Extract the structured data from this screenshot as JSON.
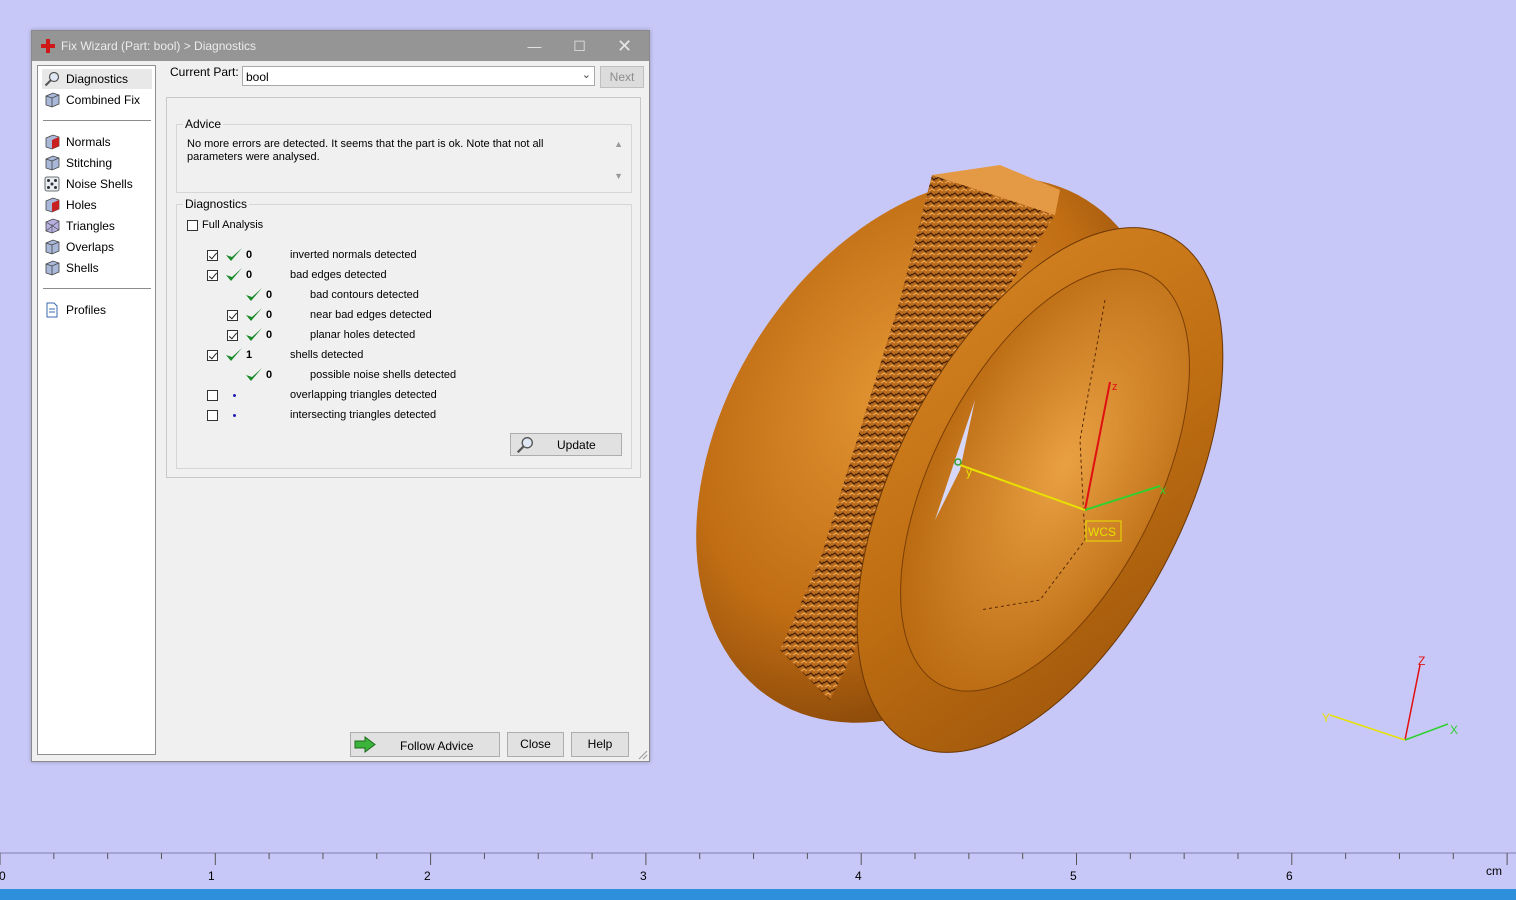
{
  "window": {
    "title": "Fix Wizard (Part: bool) > Diagnostics"
  },
  "nav": {
    "items": [
      {
        "label": "Diagnostics",
        "icon": "magnifier-icon"
      },
      {
        "label": "Combined Fix",
        "icon": "cube-icon"
      },
      {
        "label": "Normals",
        "icon": "cube-red-icon"
      },
      {
        "label": "Stitching",
        "icon": "cube-icon"
      },
      {
        "label": "Noise Shells",
        "icon": "dice-icon"
      },
      {
        "label": "Holes",
        "icon": "cube-icon"
      },
      {
        "label": "Triangles",
        "icon": "cube-icon"
      },
      {
        "label": "Overlaps",
        "icon": "cube-icon"
      },
      {
        "label": "Shells",
        "icon": "cube-icon"
      },
      {
        "label": "Profiles",
        "icon": "document-icon"
      }
    ]
  },
  "current_part": {
    "label": "Current Part:",
    "value": "bool",
    "next_label": "Next"
  },
  "advice": {
    "title": "Advice",
    "text": "No more errors are detected. It seems that the part is ok. Note that not all parameters were analysed."
  },
  "diagnostics": {
    "title": "Diagnostics",
    "full_analysis_label": "Full Analysis",
    "rows": [
      {
        "count": "0",
        "label": "inverted normals detected"
      },
      {
        "count": "0",
        "label": "bad edges detected"
      },
      {
        "count": "0",
        "label": "bad contours detected"
      },
      {
        "count": "0",
        "label": "near bad edges detected"
      },
      {
        "count": "0",
        "label": "planar holes detected"
      },
      {
        "count": "1",
        "label": "shells detected"
      },
      {
        "count": "0",
        "label": "possible noise shells detected"
      },
      {
        "count": "",
        "label": "overlapping triangles detected"
      },
      {
        "count": "",
        "label": "intersecting triangles detected"
      }
    ],
    "update_label": "Update"
  },
  "footer": {
    "follow_advice_label": "Follow Advice",
    "close_label": "Close",
    "help_label": "Help"
  },
  "viewport": {
    "wcs_label": "WCS",
    "axis_x": "x",
    "axis_y": "y",
    "axis_z": "z",
    "triad_x": "X",
    "triad_y": "Y",
    "triad_z": "Z"
  },
  "ruler": {
    "ticks": [
      "0",
      "1",
      "2",
      "3",
      "4",
      "5",
      "6"
    ],
    "unit": "cm"
  },
  "colors": {
    "background": "#c8c8f8",
    "part": "#c87a1e",
    "check": "#1a8a2a",
    "title_bar": "#959595"
  }
}
